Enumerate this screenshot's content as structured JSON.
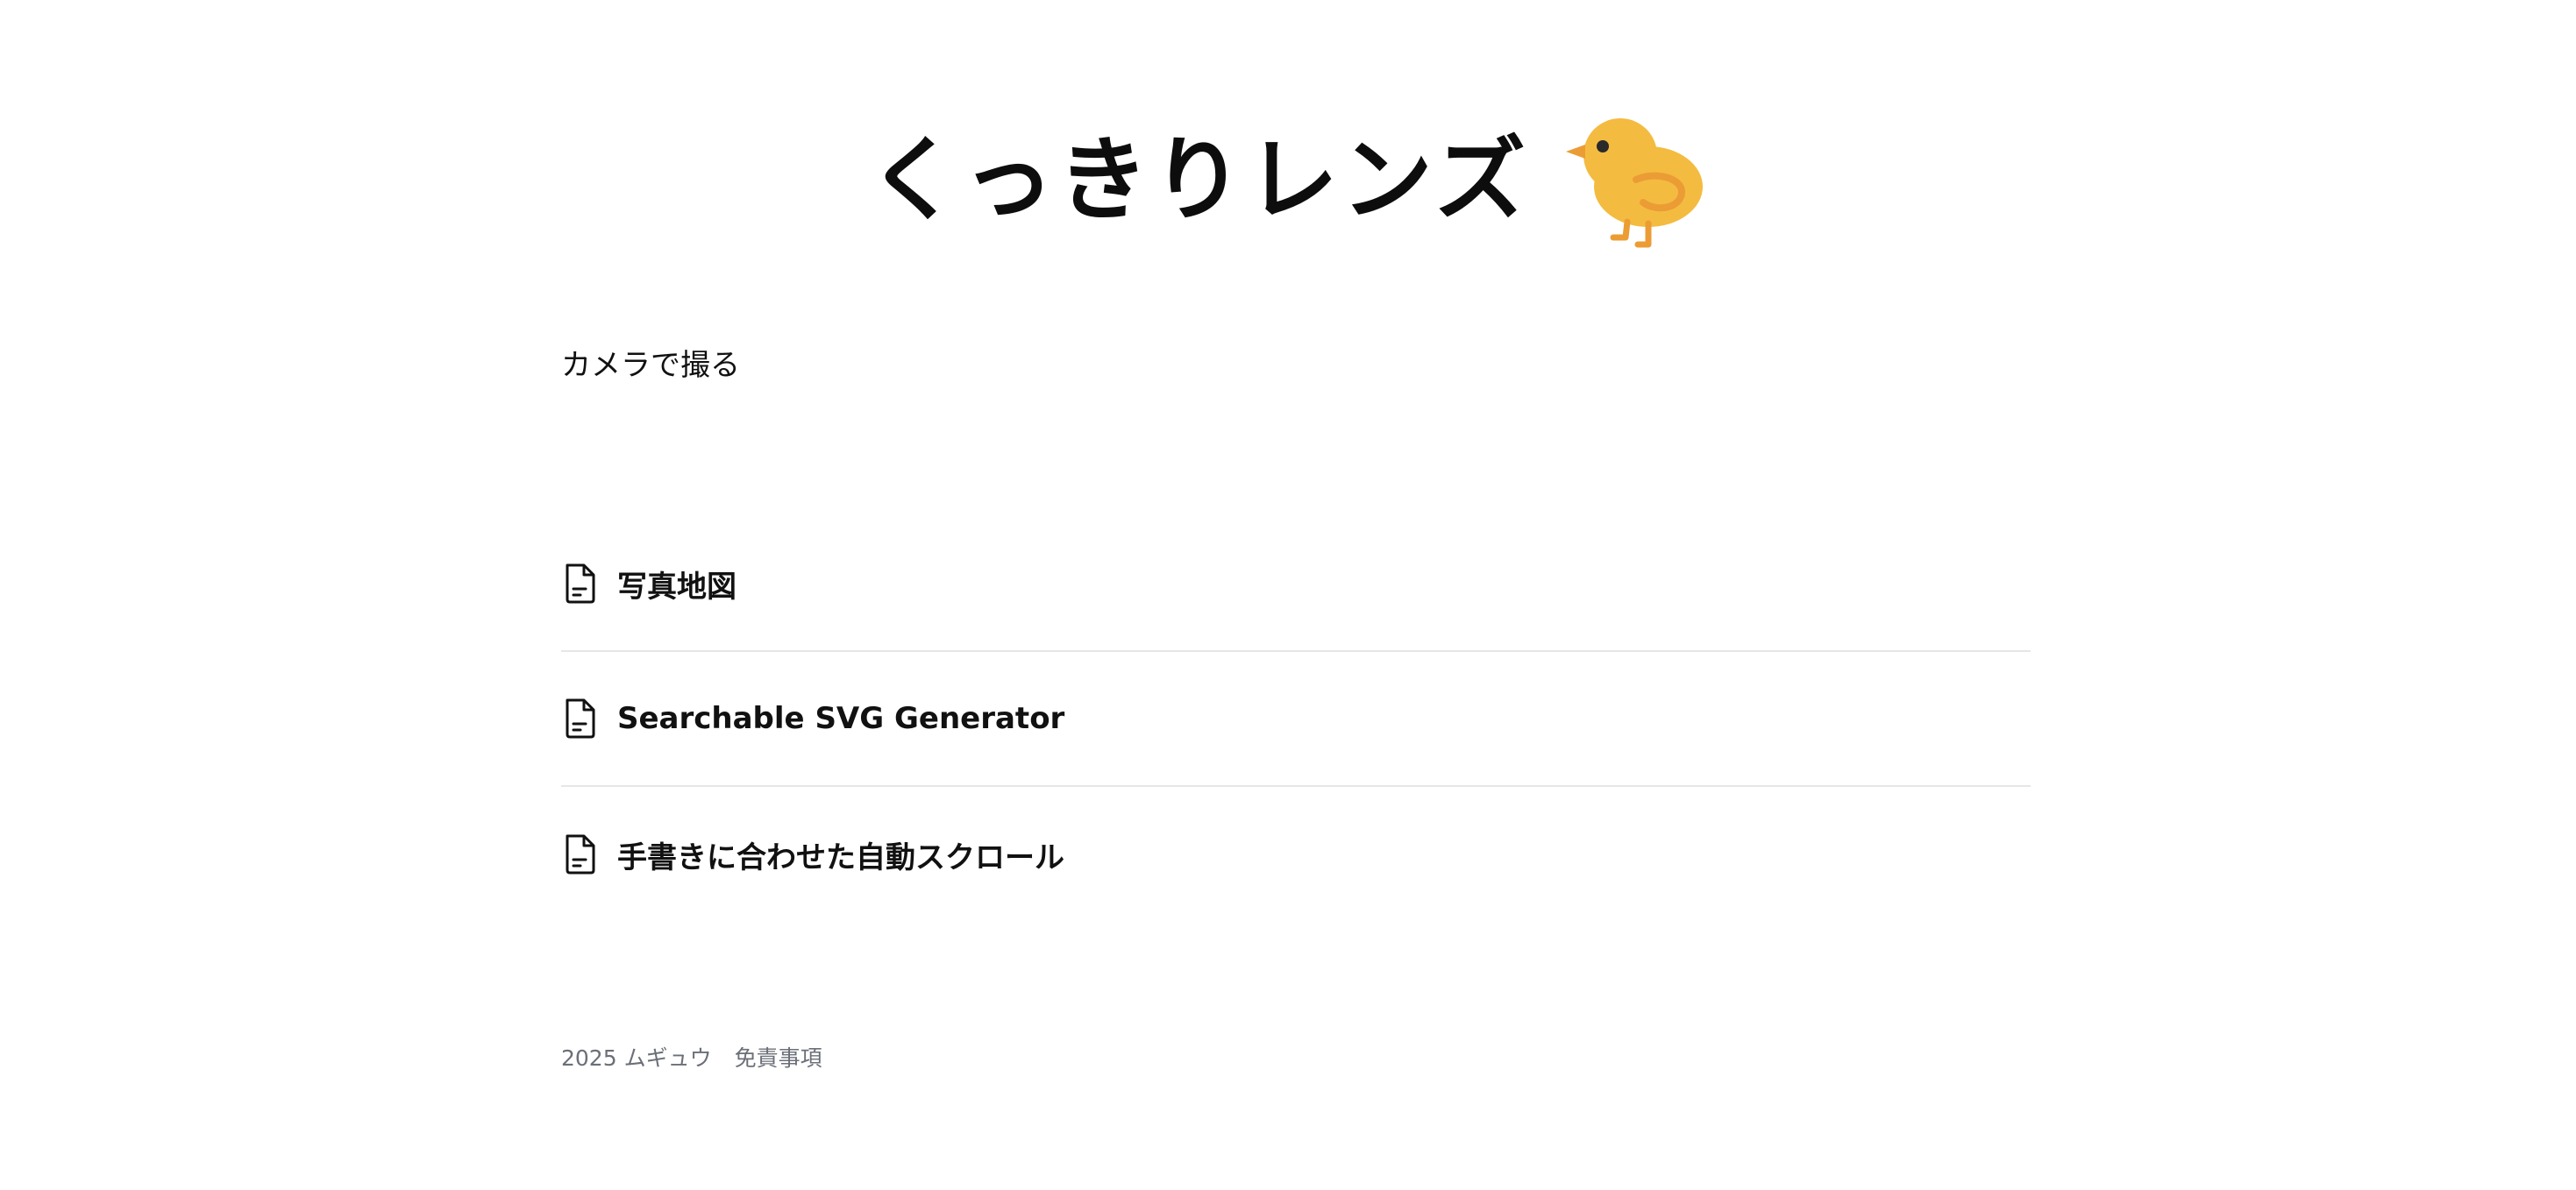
{
  "header": {
    "site_title": "くっきりレンズ",
    "mascot_icon": "baby-chick-icon"
  },
  "main": {
    "camera_link": "カメラで撮る"
  },
  "articles": [
    {
      "title": "写真地図",
      "icon": "document-icon"
    },
    {
      "title": "Searchable SVG Generator",
      "icon": "document-icon"
    },
    {
      "title": "手書きに合わせた自動スクロール",
      "icon": "document-icon"
    }
  ],
  "footer": {
    "copyright": "2025 ムギュウ",
    "disclaimer_link": "免責事項"
  },
  "colors": {
    "chick_body": "#F4BB41",
    "chick_accent": "#EC9C34",
    "text": "#111111",
    "muted": "#6B6F78",
    "divider": "#E6E6E6"
  }
}
